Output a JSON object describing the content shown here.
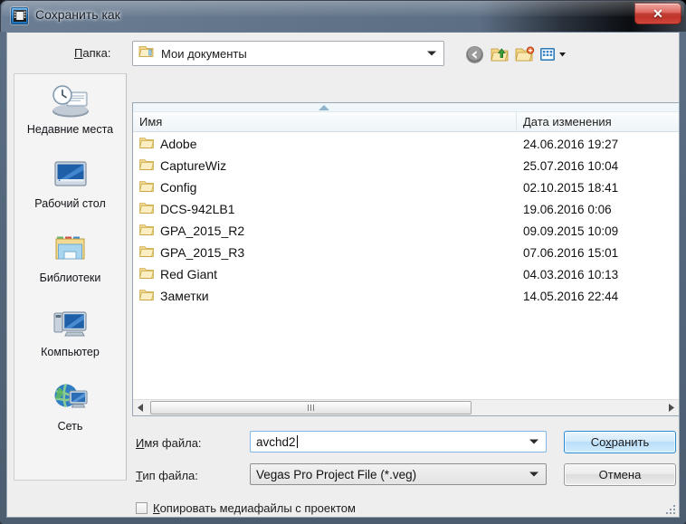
{
  "window": {
    "title": "Сохранить как",
    "app_icon": "film-strip-icon",
    "close_label": "✕"
  },
  "toolbar": {
    "lookin_label_prefix": "",
    "lookin_label": "Папка:",
    "lookin_accel": "П",
    "lookin_rest": "апка:",
    "current_folder": "Мои документы",
    "buttons": [
      {
        "name": "back-button",
        "icon": "back-arrow-icon",
        "title": "Назад"
      },
      {
        "name": "up-folder-button",
        "icon": "up-folder-icon",
        "title": "Вверх"
      },
      {
        "name": "new-folder-button",
        "icon": "new-folder-icon",
        "title": "Создать папку"
      },
      {
        "name": "views-button",
        "icon": "views-icon",
        "title": "Виды"
      }
    ]
  },
  "places": [
    {
      "label": "Недавние места",
      "icon": "recent-places-icon"
    },
    {
      "label": "Рабочий стол",
      "icon": "desktop-icon"
    },
    {
      "label": "Библиотеки",
      "icon": "libraries-icon"
    },
    {
      "label": "Компьютер",
      "icon": "computer-icon"
    },
    {
      "label": "Сеть",
      "icon": "network-icon"
    }
  ],
  "filelist": {
    "columns": {
      "name": "Имя",
      "date": "Дата изменения"
    },
    "sort": {
      "column": "Имя",
      "direction": "ascending"
    },
    "rows": [
      {
        "name": "Adobe",
        "date": "24.06.2016 19:27"
      },
      {
        "name": "CaptureWiz",
        "date": "25.07.2016 10:04"
      },
      {
        "name": "Config",
        "date": "02.10.2015 18:41"
      },
      {
        "name": "DCS-942LB1",
        "date": "19.06.2016 0:06"
      },
      {
        "name": "GPA_2015_R2",
        "date": "09.09.2015 10:09"
      },
      {
        "name": "GPA_2015_R3",
        "date": "07.06.2016 15:01"
      },
      {
        "name": "Red Giant",
        "date": "04.03.2016 10:13"
      },
      {
        "name": "Заметки",
        "date": "14.05.2016 22:44"
      }
    ]
  },
  "form": {
    "filename_label_accel": "И",
    "filename_label_rest": "мя файла:",
    "filename_value": "avchd2",
    "filetype_label_accel": "Т",
    "filetype_label_rest": "ип файла:",
    "filetype_value": "Vegas Pro Project File (*.veg)",
    "checkbox_accel": "К",
    "checkbox_rest": "опировать медиафайлы с проектом",
    "checkbox_checked": false,
    "save_label": "Сохранить",
    "save_accel": "х",
    "cancel_label": "Отмена"
  },
  "colors": {
    "accent": "#2a8ad4",
    "close_red": "#b92b22",
    "titlebar": "#60728a",
    "client_bg": "#efeeee",
    "list_bg": "#ffffff",
    "folder_yellow": "#f5d98a"
  }
}
